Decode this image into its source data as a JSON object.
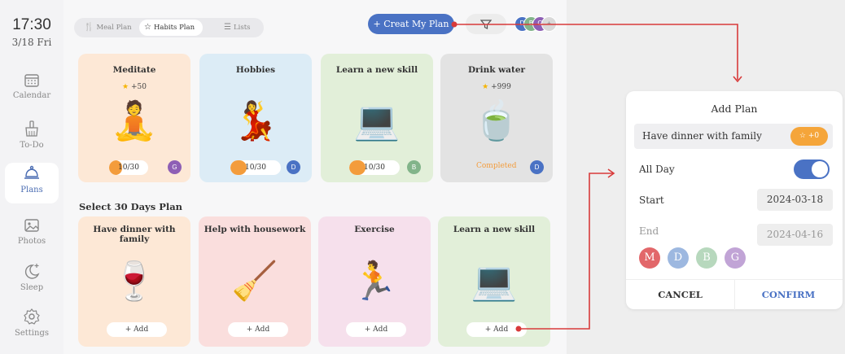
{
  "sidebar": {
    "time": "17:30",
    "date": "3/18 Fri",
    "items": [
      {
        "label": "Calendar"
      },
      {
        "label": "To-Do"
      },
      {
        "label": "Plans"
      },
      {
        "label": "Photos"
      },
      {
        "label": "Sleep"
      },
      {
        "label": "Settings"
      }
    ]
  },
  "tabs": [
    {
      "label": "Meal Plan",
      "icon": "fork-knife-icon"
    },
    {
      "label": "Habits Plan",
      "icon": "star-icon"
    },
    {
      "label": "Lists",
      "icon": "list-icon"
    }
  ],
  "header": {
    "create_label": "+ Creat My Plan",
    "avatars": [
      "D",
      "B",
      "G",
      "+"
    ]
  },
  "habits": [
    {
      "title": "Meditate",
      "points": "+50",
      "emoji": "🧘",
      "progress_text": "10/30",
      "progress": 0.33,
      "member": "G",
      "member_color": "#8e5fb5",
      "bg": "#fde8d6"
    },
    {
      "title": "Hobbies",
      "points": "",
      "emoji": "💃",
      "progress_text": "10/30",
      "progress": 0.33,
      "member": "D",
      "member_color": "#4a72c4",
      "bg": "#dcecf6"
    },
    {
      "title": "Learn a new skill",
      "points": "",
      "emoji": "💻",
      "progress_text": "10/30",
      "progress": 0.33,
      "member": "B",
      "member_color": "#82b48a",
      "bg": "#e2efd9"
    },
    {
      "title": "Drink water",
      "points": "+999",
      "emoji": "🍵",
      "progress_text": "",
      "status": "Completed",
      "member": "D",
      "member_color": "#4a72c4",
      "bg": "#e3e3e3"
    }
  ],
  "section_title": "Select 30 Days Plan",
  "plans": [
    {
      "title": "Have dinner with family",
      "emoji": "🍷",
      "add_label": "+ Add",
      "bg": "#fde8d6"
    },
    {
      "title": "Help with housework",
      "emoji": "🧹",
      "add_label": "+ Add",
      "bg": "#fadedd"
    },
    {
      "title": "Exercise",
      "emoji": "🏃",
      "add_label": "+ Add",
      "bg": "#f6e0ec"
    },
    {
      "title": "Learn a new skill",
      "emoji": "💻",
      "add_label": "+ Add",
      "bg": "#e2efd9"
    }
  ],
  "add_plan": {
    "title": "Add Plan",
    "plan_name": "Have dinner with family",
    "points": "+0",
    "all_day_label": "All Day",
    "all_day_on": true,
    "start_label": "Start",
    "start_date": "2024-03-18",
    "end_label": "End",
    "end_date": "2024-04-16",
    "members": [
      {
        "initial": "M",
        "color": "#e2676a"
      },
      {
        "initial": "D",
        "color": "#9db8e0"
      },
      {
        "initial": "B",
        "color": "#b7d8bd"
      },
      {
        "initial": "G",
        "color": "#c1a4d6"
      }
    ],
    "cancel_label": "CANCEL",
    "confirm_label": "CONFIRM"
  },
  "colors": {
    "accent": "#4a72c4",
    "orange": "#f39c3c",
    "arrow": "#d83a3a"
  }
}
